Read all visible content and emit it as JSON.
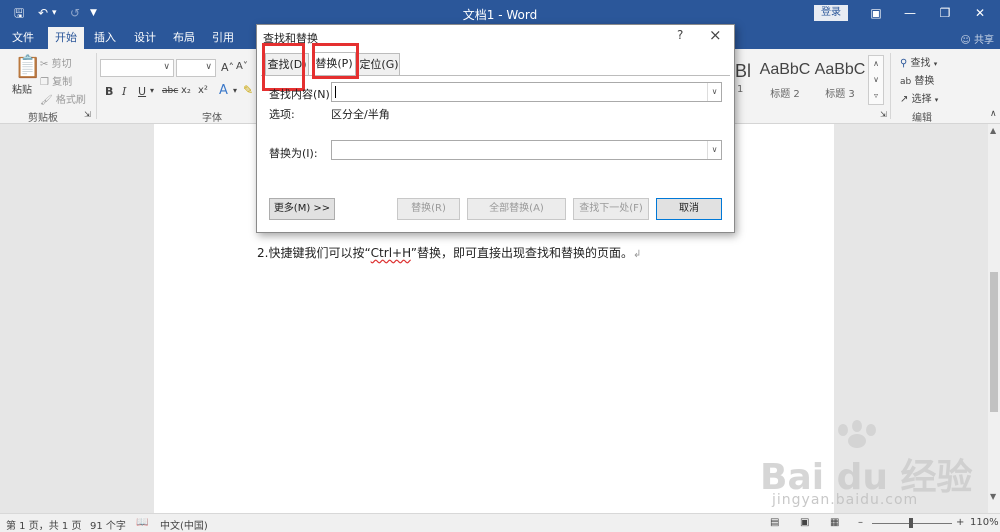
{
  "window": {
    "title": "文档1 - Word",
    "login_label": "登录"
  },
  "tabs": [
    {
      "label": "文件"
    },
    {
      "label": "开始"
    },
    {
      "label": "插入"
    },
    {
      "label": "设计"
    },
    {
      "label": "布局"
    },
    {
      "label": "引用"
    }
  ],
  "share_label": "共享",
  "ribbon": {
    "clipboard": {
      "paste": "粘贴",
      "cut": "剪切",
      "copy": "复制",
      "format_painter": "格式刷",
      "group_label": "剪贴板"
    },
    "font": {
      "group_label": "字体",
      "bold": "B",
      "italic": "I",
      "underline": "U",
      "strike": "abc",
      "subscript": "x₂",
      "superscript": "x²",
      "grow": "A˄",
      "shrink": "A˅"
    },
    "styles": [
      {
        "sample": "AaBbC",
        "name": "标题 2"
      },
      {
        "sample": "AaBbC",
        "name": "标题 3"
      }
    ],
    "styles_partial_sample": "Bl",
    "styles_partial_name": "1",
    "editing": {
      "find": "查找",
      "replace": "替换",
      "select": "选择",
      "group_label": "编辑"
    }
  },
  "dialog": {
    "title": "查找和替换",
    "help": "?",
    "tabs": [
      {
        "label": "查找(D)"
      },
      {
        "label": "替换(P)"
      },
      {
        "label": "定位(G)"
      }
    ],
    "find_label": "查找内容(N):",
    "find_value": "",
    "options_label": "选项:",
    "options_value": "区分全/半角",
    "replace_label": "替换为(I):",
    "replace_value": "",
    "buttons": {
      "more": "更多(M) >>",
      "replace": "替换(R)",
      "replace_all": "全部替换(A)",
      "find_next": "查找下一处(F)",
      "cancel": "取消"
    }
  },
  "document": {
    "text_before": "2.快捷键我们可以按“",
    "text_key": "Ctrl+H",
    "text_after": "”替换，即可直接出现查找和替换的页面。"
  },
  "status": {
    "page": "第 1 页，共 1 页",
    "words": "91 个字",
    "language": "中文(中国)",
    "zoom": "110%"
  },
  "watermark": {
    "text": "Bai du 经验",
    "url": "jingyan.baidu.com"
  }
}
